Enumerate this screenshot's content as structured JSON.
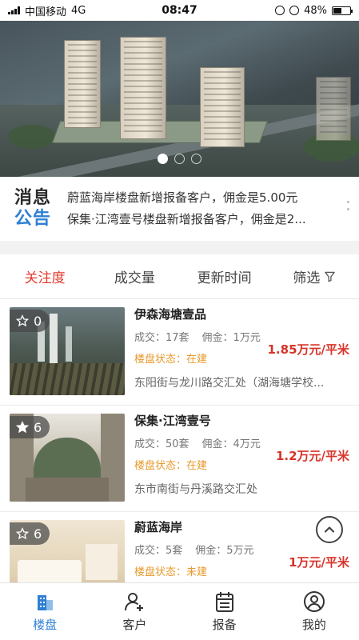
{
  "status_bar": {
    "carrier": "中国移动",
    "network": "4G",
    "time": "08:47",
    "battery": "48%",
    "battery_level": 0.48
  },
  "banner": {
    "slides": 3,
    "active_index": 0
  },
  "notice": {
    "logo_top": "消息",
    "logo_bottom": "公告",
    "items": [
      "蔚蓝海岸楼盘新增报备客户，佣金是5.00元",
      "保集·江湾壹号楼盘新增报备客户，佣金是2..."
    ]
  },
  "sort_tabs": [
    {
      "label": "关注度",
      "active": true
    },
    {
      "label": "成交量",
      "active": false
    },
    {
      "label": "更新时间",
      "active": false
    },
    {
      "label": "筛选",
      "active": false
    }
  ],
  "properties": [
    {
      "name": "伊森海塘壹品",
      "favorites": "0",
      "starred": false,
      "deals": "成交：17套",
      "commission": "佣金：1万元",
      "status": "楼盘状态：在建",
      "price": "1.85万元/平米",
      "address": "东阳街与龙川路交汇处（湖海塘学校..."
    },
    {
      "name": "保集·江湾壹号",
      "favorites": "6",
      "starred": true,
      "deals": "成交：50套",
      "commission": "佣金：4万元",
      "status": "楼盘状态：在建",
      "price": "1.2万元/平米",
      "address": "东市南街与丹溪路交汇处"
    },
    {
      "name": "蔚蓝海岸",
      "favorites": "6",
      "starred": false,
      "deals": "成交：5套",
      "commission": "佣金：5万元",
      "status": "楼盘状态：未建",
      "price": "1万元/平米",
      "address": ""
    }
  ],
  "tab_bar": [
    {
      "label": "楼盘",
      "icon": "building-icon",
      "active": true
    },
    {
      "label": "客户",
      "icon": "add-user-icon",
      "active": false
    },
    {
      "label": "报备",
      "icon": "calendar-list-icon",
      "active": false
    },
    {
      "label": "我的",
      "icon": "user-circle-icon",
      "active": false
    }
  ],
  "colors": {
    "accent_blue": "#2f7fd3",
    "active_red": "#e23a2e",
    "price_red": "#d7342a",
    "status_orange": "#e89a2c"
  }
}
